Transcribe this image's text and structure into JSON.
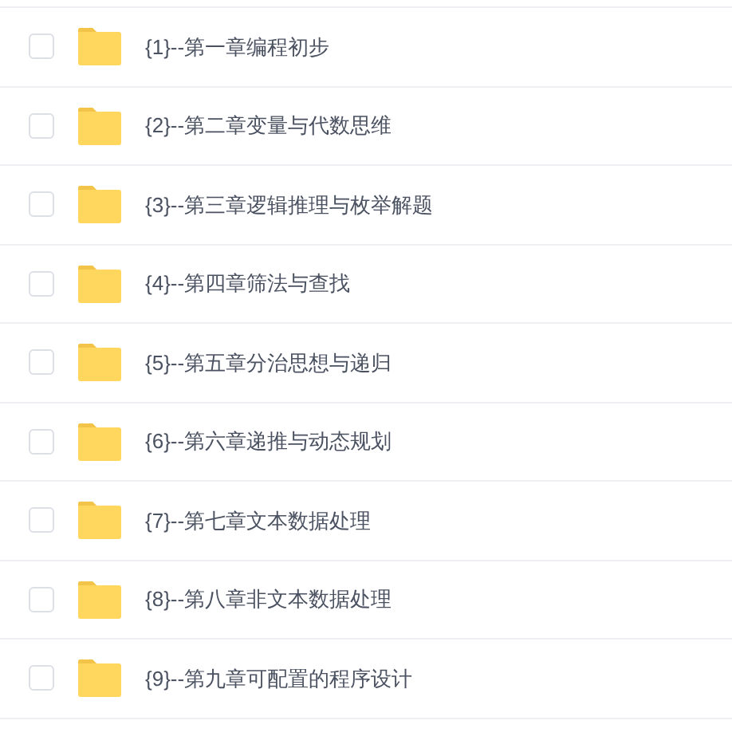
{
  "folders": [
    {
      "name": "{1}--第一章编程初步",
      "checked": false
    },
    {
      "name": "{2}--第二章变量与代数思维",
      "checked": false
    },
    {
      "name": "{3}--第三章逻辑推理与枚举解题",
      "checked": false
    },
    {
      "name": "{4}--第四章筛法与查找",
      "checked": false
    },
    {
      "name": "{5}--第五章分治思想与递归",
      "checked": false
    },
    {
      "name": "{6}--第六章递推与动态规划",
      "checked": false
    },
    {
      "name": "{7}--第七章文本数据处理",
      "checked": false
    },
    {
      "name": "{8}--第八章非文本数据处理",
      "checked": false
    },
    {
      "name": "{9}--第九章可配置的程序设计",
      "checked": false
    }
  ]
}
